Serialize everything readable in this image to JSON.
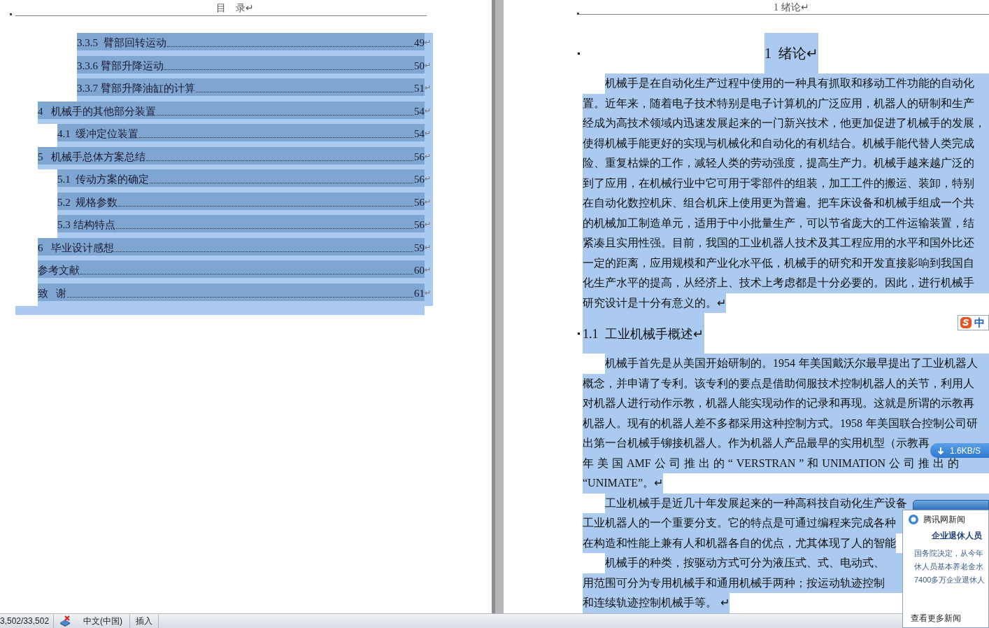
{
  "left_page": {
    "header": "目　录↵",
    "toc": [
      {
        "kind": "subsubsection",
        "title": "3.3.5  臂部回转运动",
        "page": "49",
        "mark": "↵",
        "selected": true
      },
      {
        "kind": "subsubsection",
        "title": "3.3.6 臂部升降运动",
        "page": "50",
        "mark": "↵",
        "selected": true
      },
      {
        "kind": "subsubsection",
        "title": "3.3.7 臂部升降油缸的计算",
        "page": "51",
        "mark": "↵",
        "selected": true
      },
      {
        "kind": "chapter",
        "title": "4   机械手的其他部分装置",
        "page": "54",
        "mark": "↵",
        "selected": true
      },
      {
        "kind": "section",
        "title": "4.1  缓冲定位装置",
        "page": "54",
        "mark": "↵",
        "selected": true
      },
      {
        "kind": "chapter",
        "title": "5   机械手总体方案总结",
        "page": "56",
        "mark": "↵",
        "selected": true
      },
      {
        "kind": "section",
        "title": "5.1  传动方案的确定",
        "page": "56",
        "mark": "↵",
        "selected": true
      },
      {
        "kind": "section",
        "title": "5.2  规格参数",
        "page": "56",
        "mark": "↵",
        "selected": true
      },
      {
        "kind": "section",
        "title": "5.3 结构特点",
        "page": "56",
        "mark": "↵",
        "selected": true
      },
      {
        "kind": "chapter",
        "title": "6   毕业设计感想",
        "page": "59",
        "mark": "↵",
        "selected": true
      },
      {
        "kind": "chapter",
        "title": "参考文献",
        "page": "60",
        "mark": "↵",
        "selected": true
      },
      {
        "kind": "chapter",
        "title": "致   谢",
        "page": "61",
        "mark": "↵",
        "selected": true
      }
    ]
  },
  "right_page": {
    "header": "1 绪论↵",
    "blocks": [
      {
        "kind": "heading1",
        "text": "1  绪论↵",
        "selected": true
      },
      {
        "kind": "paragraph",
        "selected": true,
        "lines": [
          "机械手是在自动化生产过程中使用的一种具有抓取和移动工件功能的自动化",
          "置。近年来，随着电子技术特别是电子计算机的广泛应用，机器人的研制和生产",
          "经成为高技术领域内迅速发展起来的一门新兴技术，他更加促进了机械手的发展，",
          "使得机械手能更好的实现与机械化和自动化的有机结合。机械手能代替人类完成",
          "险、重复枯燥的工作，减轻人类的劳动强度，提高生产力。机械手越来越广泛的",
          "到了应用，在机械行业中它可用于零部件的组装，加工工件的搬运、装卸，特别",
          "在自动化数控机床、组合机床上使用更为普遍。把车床设备和机械手组成一个共",
          "的机械加工制造单元，适用于中小批量生产，可以节省庞大的工件运输装置，结",
          "紧凑且实用性强。目前，我国的工业机器人技术及其工程应用的水平和国外比还",
          "一定的距离，应用规模和产业化水平低，机械手的研究和开发直接影响到我国自",
          "化生产水平的提高，从经济上、技术上考虑都是十分必要的。因此，进行机械手",
          "研究设计是十分有意义的。↵"
        ]
      },
      {
        "kind": "heading2",
        "text": "1.1  工业机械手概述↵",
        "selected": true
      },
      {
        "kind": "paragraph",
        "selected": true,
        "lines": [
          "机械手首先是从美国开始研制的。1954 年美国戴沃尔最早提出了工业机器人",
          "概念，并申请了专利。该专利的要点是借助伺服技术控制机器人的关节，利用人",
          "对机器人进行动作示教，机器人能实现动作的记录和再现。这就是所谓的示教再",
          "机器人。现有的机器人差不多都采用这种控制方式。1958 年美国联合控制公司研",
          "出第一台机械手铆接机器人。作为机器人产品最早的实用机型（示教再",
          "年 美 国 AMF 公 司 推 出 的 “ VERSTRAN ” 和 UNIMATION 公 司 推 出 的",
          "“UNIMATE”。↵"
        ]
      },
      {
        "kind": "paragraph",
        "selected": true,
        "lines": [
          "工业机械手是近几十年发展起来的一种高科技自动化生产设备",
          "工业机器人的一个重要分支。它的特点是可通过编程来完成各种",
          "在构造和性能上兼有人和机器各自的优点，尤其体现了人的智能"
        ]
      },
      {
        "kind": "paragraph",
        "selected": true,
        "lines": [
          "机械手的种类，按驱动方式可分为液压式、式、电动式、",
          "用范围可分为专用机械手和通用机械手两种；按运动轨迹控制",
          "和连续轨迹控制机械手等。 ↵"
        ]
      }
    ]
  },
  "ime_indicator": {
    "label": "中"
  },
  "download_badge": {
    "speed": "1.6KB/S"
  },
  "news_popup": {
    "source": "腾讯网新闻",
    "headline": "企业退休人员",
    "lines": [
      "国务院决定，从今年",
      "休人员基本养老金水",
      "7400多万企业退休人"
    ],
    "link": "查看更多新闻"
  },
  "status_bar": {
    "word_count": "3,502/33,502",
    "language": "中文(中国)",
    "mode": "插入"
  }
}
